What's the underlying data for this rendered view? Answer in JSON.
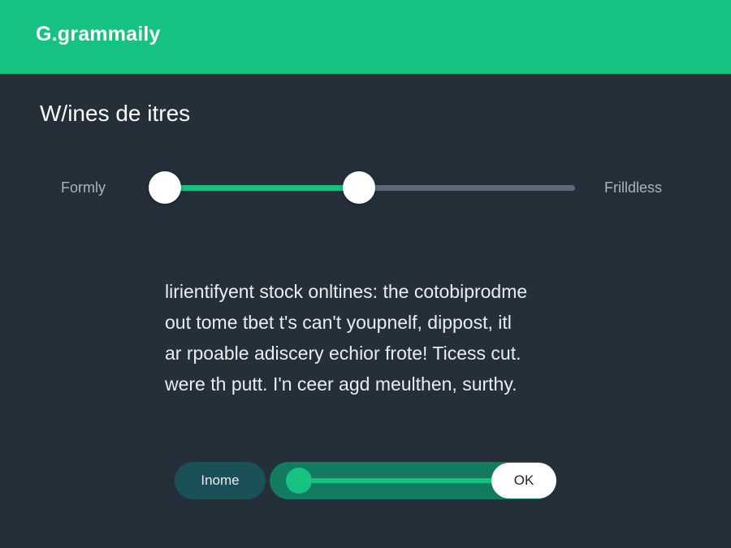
{
  "header": {
    "logo_mark": "G.",
    "logo_word": "grammaily",
    "color": "#15c281"
  },
  "page": {
    "title": "W/ines de itres"
  },
  "slider": {
    "left_label": "Formly",
    "right_label": "Frilldless",
    "lower_value_percent": 0,
    "upper_value_percent": 47
  },
  "body_text": {
    "lines": [
      "lirientifyent stock onltines: the cotobiprodme",
      "out tome tbet t's can't youpnelf, dippost, itl",
      "ar rpoable adiscery echior frote! Ticess cut.",
      "were th putt. I'n ceer agd meulthen, surthy."
    ]
  },
  "footer": {
    "secondary_button_label": "Inome",
    "ok_button_label": "OK",
    "toggle_value_percent": 0
  },
  "colors": {
    "accent": "#15c281",
    "background": "#242f3a",
    "secondary_button": "#1c5058"
  }
}
